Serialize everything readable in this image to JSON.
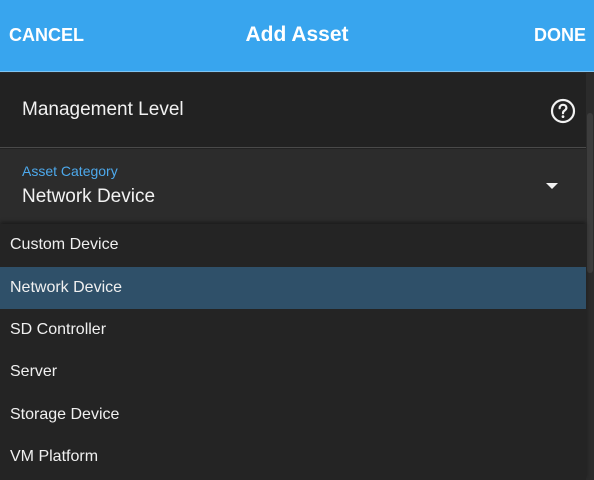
{
  "header": {
    "cancel_label": "CANCEL",
    "title": "Add Asset",
    "done_label": "DONE"
  },
  "form": {
    "management_level_label": "Management Level",
    "asset_category": {
      "label": "Asset Category",
      "value": "Network Device"
    }
  },
  "dropdown": {
    "options": [
      {
        "label": "Custom Device",
        "selected": false
      },
      {
        "label": "Network Device",
        "selected": true
      },
      {
        "label": "SD Controller",
        "selected": false
      },
      {
        "label": "Server",
        "selected": false
      },
      {
        "label": "Storage Device",
        "selected": false
      },
      {
        "label": "VM Platform",
        "selected": false
      }
    ]
  },
  "icons": {
    "help": "help-circle-icon",
    "dropdown_arrow": "caret-down-icon"
  },
  "colors": {
    "header_bg": "#38a5ee",
    "accent_label": "#4da9ec",
    "selected_item_bg": "#2f5069",
    "background": "#222222"
  }
}
